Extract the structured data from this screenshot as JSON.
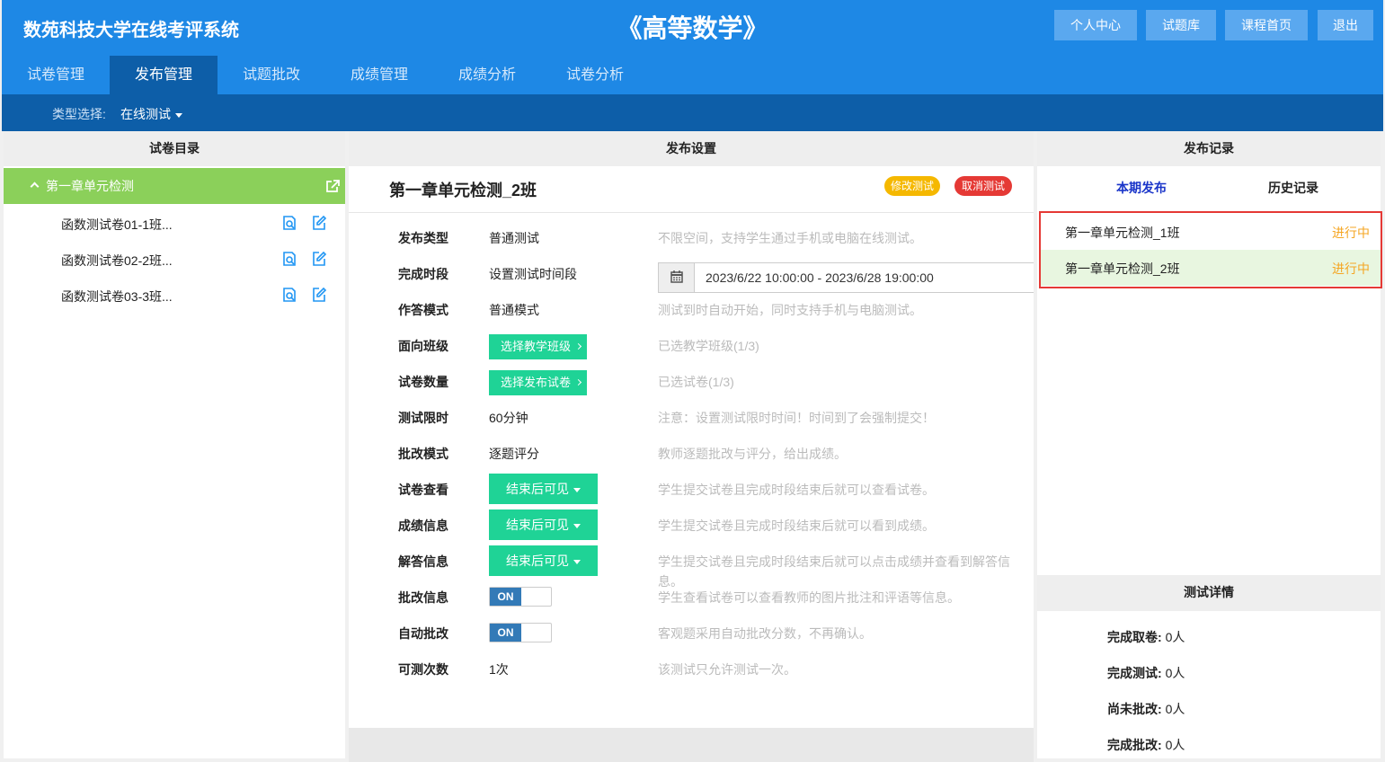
{
  "header": {
    "system_title": "数苑科技大学在线考评系统",
    "course_title": "《高等数学》",
    "buttons": [
      "个人中心",
      "试题库",
      "课程首页",
      "退出"
    ]
  },
  "nav": {
    "tabs": [
      "试卷管理",
      "发布管理",
      "试题批改",
      "成绩管理",
      "成绩分析",
      "试卷分析"
    ],
    "active": "发布管理"
  },
  "filter": {
    "label": "类型选择:",
    "value": "在线测试"
  },
  "left_panel": {
    "title": "试卷目录",
    "root": "第一章单元检测",
    "papers": [
      "函数测试卷01-1班...",
      "函数测试卷02-2班...",
      "函数测试卷03-3班..."
    ]
  },
  "middle_panel": {
    "title": "发布设置",
    "paper_title": "第一章单元检测_2班",
    "modify_label": "修改测试",
    "cancel_label": "取消测试",
    "rows": [
      {
        "label": "发布类型",
        "value": "普通测试",
        "desc": "不限空间，支持学生通过手机或电脑在线测试。"
      },
      {
        "label": "完成时段",
        "value": "设置测试时间段",
        "date_range": "2023/6/22 10:00:00 - 2023/6/28 19:00:00"
      },
      {
        "label": "作答模式",
        "value": "普通模式",
        "desc": "测试到时自动开始，同时支持手机与电脑测试。"
      },
      {
        "label": "面向班级",
        "button": "选择教学班级",
        "desc": "已选教学班级(1/3)"
      },
      {
        "label": "试卷数量",
        "button": "选择发布试卷",
        "desc": "已选试卷(1/3)"
      },
      {
        "label": "测试限时",
        "value": "60分钟",
        "desc": "注意：设置测试限时时间！时间到了会强制提交！"
      },
      {
        "label": "批改模式",
        "value": "逐题评分",
        "desc": "教师逐题批改与评分，给出成绩。"
      },
      {
        "label": "试卷查看",
        "dropdown": "结束后可见",
        "desc": "学生提交试卷且完成时段结束后就可以查看试卷。"
      },
      {
        "label": "成绩信息",
        "dropdown": "结束后可见",
        "desc": "学生提交试卷且完成时段结束后就可以看到成绩。"
      },
      {
        "label": "解答信息",
        "dropdown": "结束后可见",
        "desc": "学生提交试卷且完成时段结束后就可以点击成绩并查看到解答信",
        "desc2": "息。"
      },
      {
        "label": "批改信息",
        "toggle": "ON",
        "desc": "学生查看试卷可以查看教师的图片批注和评语等信息。"
      },
      {
        "label": "自动批改",
        "toggle": "ON",
        "desc": "客观题采用自动批改分数，不再确认。"
      },
      {
        "label": "可测次数",
        "value": "1次",
        "desc": "该测试只允许测试一次。"
      }
    ]
  },
  "right_panel": {
    "title": "发布记录",
    "tabs": [
      "本期发布",
      "历史记录"
    ],
    "records": [
      {
        "name": "第一章单元检测_1班",
        "status": "进行中"
      },
      {
        "name": "第一章单元检测_2班",
        "status": "进行中"
      }
    ],
    "detail_title": "测试详情",
    "stats": [
      {
        "label": "完成取卷:",
        "value": "0人"
      },
      {
        "label": "完成测试:",
        "value": "0人"
      },
      {
        "label": "尚未批改:",
        "value": "0人"
      },
      {
        "label": "完成批改:",
        "value": "0人"
      }
    ]
  },
  "colors": {
    "primary": "#1e88e5",
    "primary_dark": "#0d5ea8",
    "green": "#8bd05a",
    "teal": "#1fd396",
    "orange": "#f5a623",
    "red": "#e53935"
  }
}
